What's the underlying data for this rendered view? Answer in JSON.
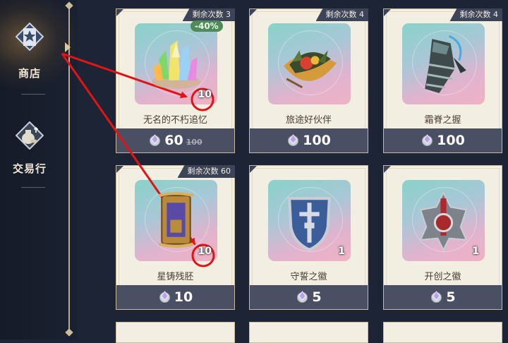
{
  "sidebar": {
    "items": [
      {
        "label": "商店",
        "icon": "star-banner-icon",
        "active": true
      },
      {
        "label": "交易行",
        "icon": "money-bag-icon",
        "active": false
      }
    ]
  },
  "shop": {
    "cards": [
      {
        "remaining": "剩余次数 3",
        "name": "无名的不朽追忆",
        "price": "60",
        "old_price": "100",
        "quantity": "10",
        "discount": "-40%",
        "icon": "crystal-cluster-icon"
      },
      {
        "remaining": "剩余次数 4",
        "name": "旅途好伙伴",
        "price": "100",
        "quantity": "",
        "icon": "food-bowl-icon"
      },
      {
        "remaining": "剩余次数 4",
        "name": "霜脊之握",
        "price": "100",
        "quantity": "",
        "icon": "armored-gauntlet-icon"
      },
      {
        "remaining": "剩余次数 60",
        "name": "星铸残胚",
        "price": "10",
        "quantity": "10",
        "icon": "framed-scroll-icon"
      },
      {
        "remaining": "",
        "name": "守誓之徽",
        "price": "5",
        "quantity": "1",
        "icon": "shield-emblem-icon"
      },
      {
        "remaining": "",
        "name": "开创之徽",
        "price": "5",
        "quantity": "1",
        "icon": "crest-emblem-icon"
      }
    ],
    "currency_icon": "crystal-coin-icon"
  },
  "annotations": {
    "highlight_color": "#e01414"
  }
}
